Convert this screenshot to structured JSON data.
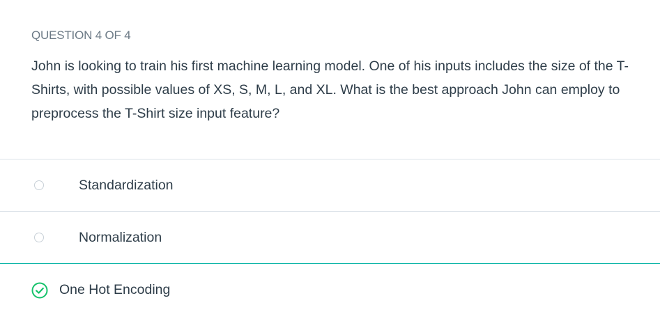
{
  "quiz": {
    "question_label": "QUESTION 4 OF 4",
    "question_text": "John is looking to train his first machine learning model. One of his inputs includes the size of the T-Shirts, with possible values of XS, S, M, L, and XL. What is the best approach John can employ to preprocess the T-Shirt size input feature?",
    "options": [
      {
        "label": "Standardization",
        "state": "unselected",
        "icon": "radio-empty-icon"
      },
      {
        "label": "Normalization",
        "state": "unselected",
        "icon": "radio-empty-icon"
      },
      {
        "label": "One Hot Encoding",
        "state": "correct",
        "icon": "check-circle-icon"
      }
    ]
  },
  "colors": {
    "text": "#2e3d49",
    "label_gray": "#6c7a86",
    "divider": "#dbe2e8",
    "correct_green": "#02b3a4",
    "check_green": "#15c26b"
  }
}
